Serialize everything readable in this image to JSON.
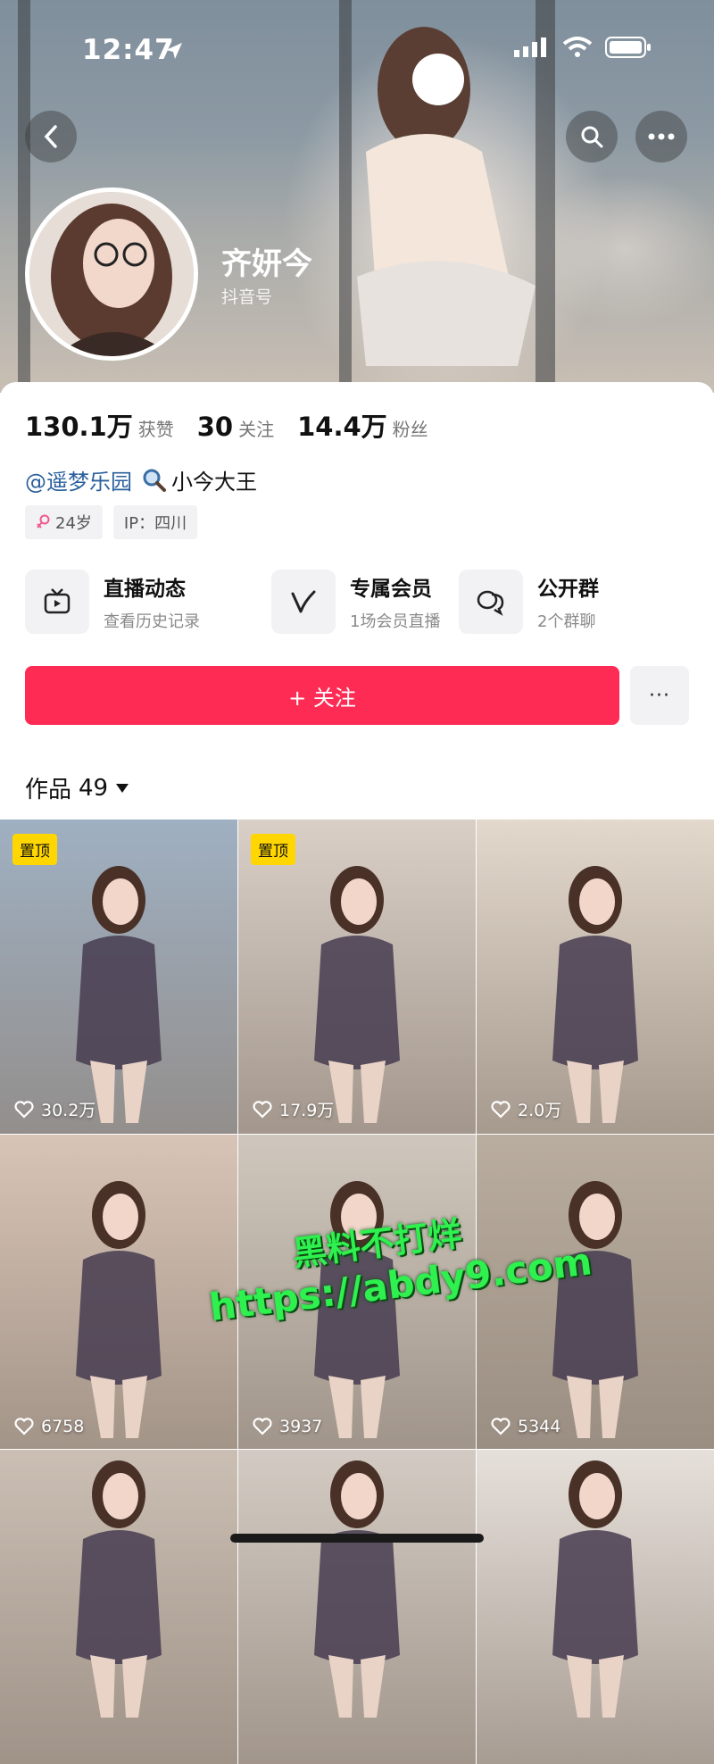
{
  "status_bar": {
    "time": "12:47"
  },
  "profile": {
    "name": "齐妍今",
    "douyin_id_label": "抖音号",
    "stats": [
      {
        "value": "130.1万",
        "label": "获赞"
      },
      {
        "value": "30",
        "label": "关注"
      },
      {
        "value": "14.4万",
        "label": "粉丝"
      }
    ],
    "handle": "@遥梦乐园",
    "search_hint": "小今大王",
    "tags": [
      {
        "icon": "female-icon",
        "text": "24岁"
      },
      {
        "icon": "",
        "text": "IP：四川"
      }
    ]
  },
  "features": [
    {
      "icon": "tv-icon",
      "title": "直播动态",
      "subtitle": "查看历史记录"
    },
    {
      "icon": "v-icon",
      "title": "专属会员",
      "subtitle": "1场会员直播"
    },
    {
      "icon": "group-chat-icon",
      "title": "公开群",
      "subtitle": "2个群聊"
    }
  ],
  "actions": {
    "follow_label": "+ 关注",
    "more_label": "···"
  },
  "works": {
    "label": "作品",
    "count": "49"
  },
  "videos": [
    {
      "pinned": "置顶",
      "likes": "30.2万",
      "bg": "#9fb0c2"
    },
    {
      "pinned": "置顶",
      "likes": "17.9万",
      "bg": "#d9cfc7"
    },
    {
      "pinned": "",
      "likes": "2.0万",
      "bg": "#e3d8cc"
    },
    {
      "pinned": "",
      "likes": "6758",
      "bg": "#d8c4b6"
    },
    {
      "pinned": "",
      "likes": "3937",
      "bg": "#cfc7bd"
    },
    {
      "pinned": "",
      "likes": "5344",
      "bg": "#b9ad9f"
    },
    {
      "pinned": "",
      "likes": "",
      "bg": "#cbbfb4"
    },
    {
      "pinned": "",
      "likes": "",
      "bg": "#d3cbc3"
    },
    {
      "pinned": "",
      "likes": "",
      "bg": "#e6e0da"
    }
  ],
  "watermark": {
    "line1": "黑料不打烊",
    "line2": "https://abdy9.com"
  },
  "colors": {
    "accent": "#fe2c55",
    "link": "#2b5f9e",
    "pin_badge": "#ffd600",
    "watermark": "#2ef04e"
  }
}
